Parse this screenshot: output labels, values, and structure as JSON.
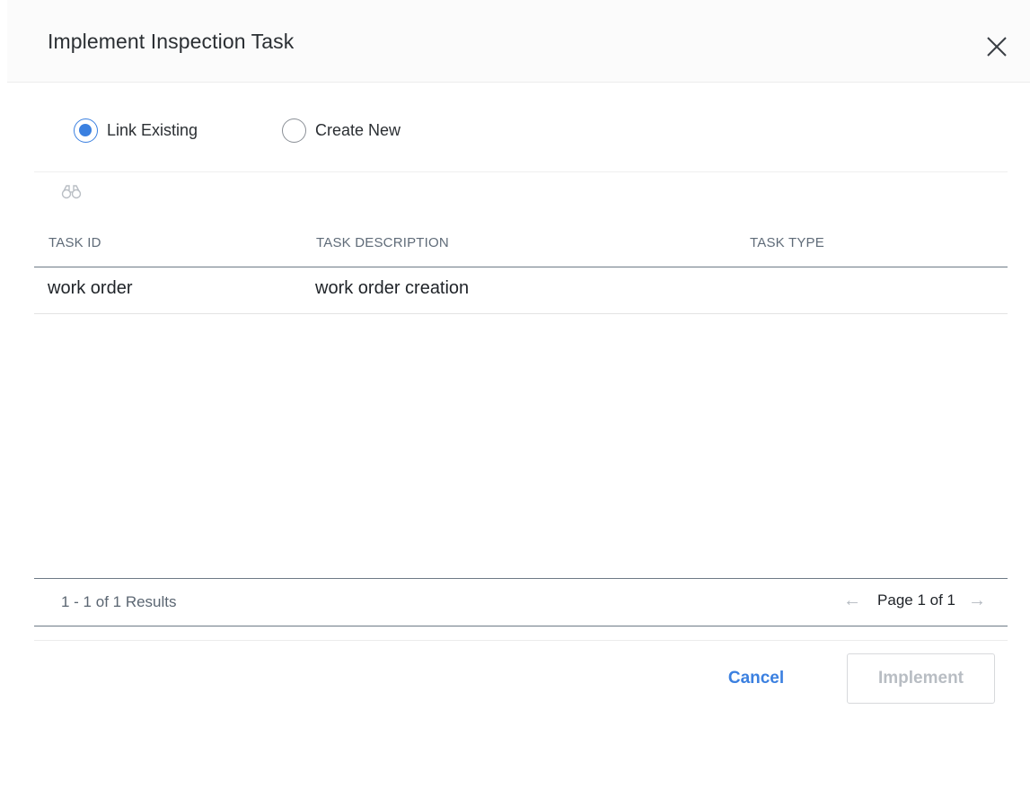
{
  "dialog": {
    "title": "Implement Inspection Task",
    "close_icon": "close-icon"
  },
  "mode": {
    "options": [
      {
        "label": "Link Existing",
        "selected": true
      },
      {
        "label": "Create New",
        "selected": false
      }
    ],
    "accent_color": "#3b80e0"
  },
  "toolbar": {
    "search_icon": "binoculars-icon"
  },
  "table": {
    "columns": [
      "TASK ID",
      "TASK DESCRIPTION",
      "TASK TYPE"
    ],
    "rows": [
      {
        "task_id": "work order",
        "task_description": "work order creation",
        "task_type": ""
      }
    ]
  },
  "pagination": {
    "results_text": "1 - 1 of 1 Results",
    "page_text": "Page 1 of 1",
    "prev_icon": "arrow-left-icon",
    "next_icon": "arrow-right-icon"
  },
  "actions": {
    "cancel_label": "Cancel",
    "implement_label": "Implement",
    "implement_enabled": false
  }
}
